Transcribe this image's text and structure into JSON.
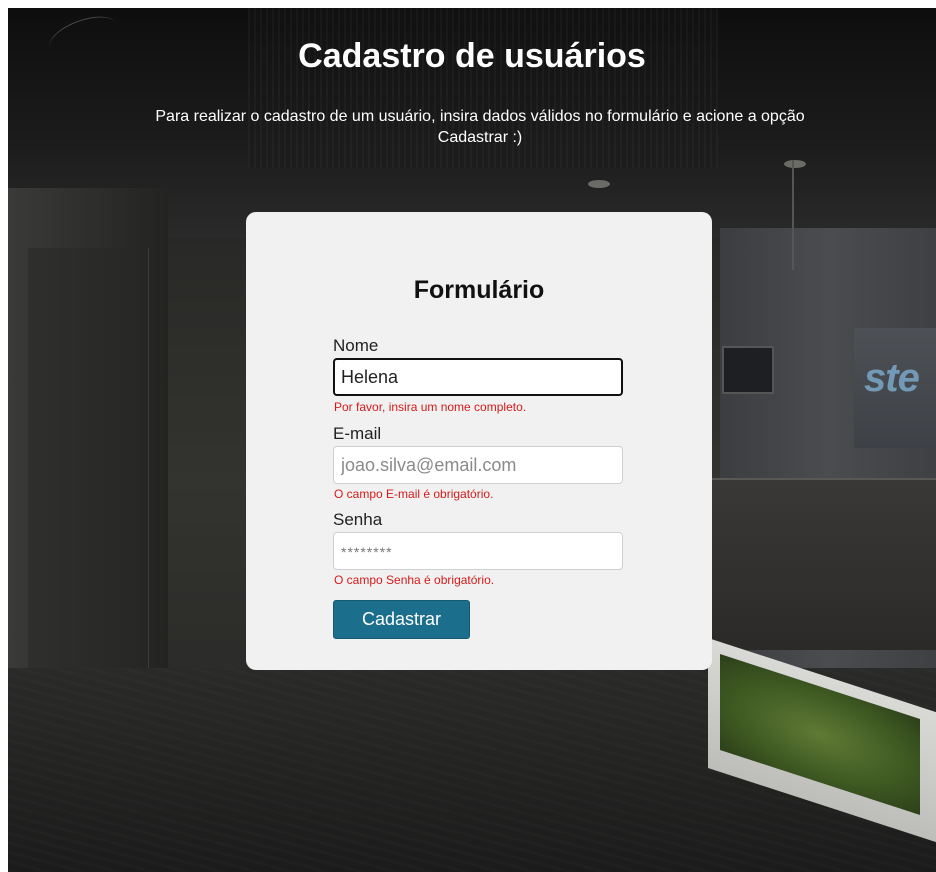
{
  "page": {
    "title": "Cadastro de usuários",
    "subtitle": "Para realizar o cadastro de um usuário, insira dados válidos no formulário e acione a opção Cadastrar :)"
  },
  "form": {
    "title": "Formulário",
    "name": {
      "label": "Nome",
      "value": "Helena",
      "error": "Por favor, insira um nome completo."
    },
    "email": {
      "label": "E-mail",
      "placeholder": "joao.silva@email.com",
      "error": "O campo E-mail é obrigatório."
    },
    "password": {
      "label": "Senha",
      "placeholder": "********",
      "error": "O campo Senha é obrigatório."
    },
    "submit_label": "Cadastrar"
  },
  "background": {
    "logo_text": "ste"
  },
  "colors": {
    "button": "#1c6f8c",
    "error": "#d61a1a",
    "card": "#f1f1f1"
  }
}
